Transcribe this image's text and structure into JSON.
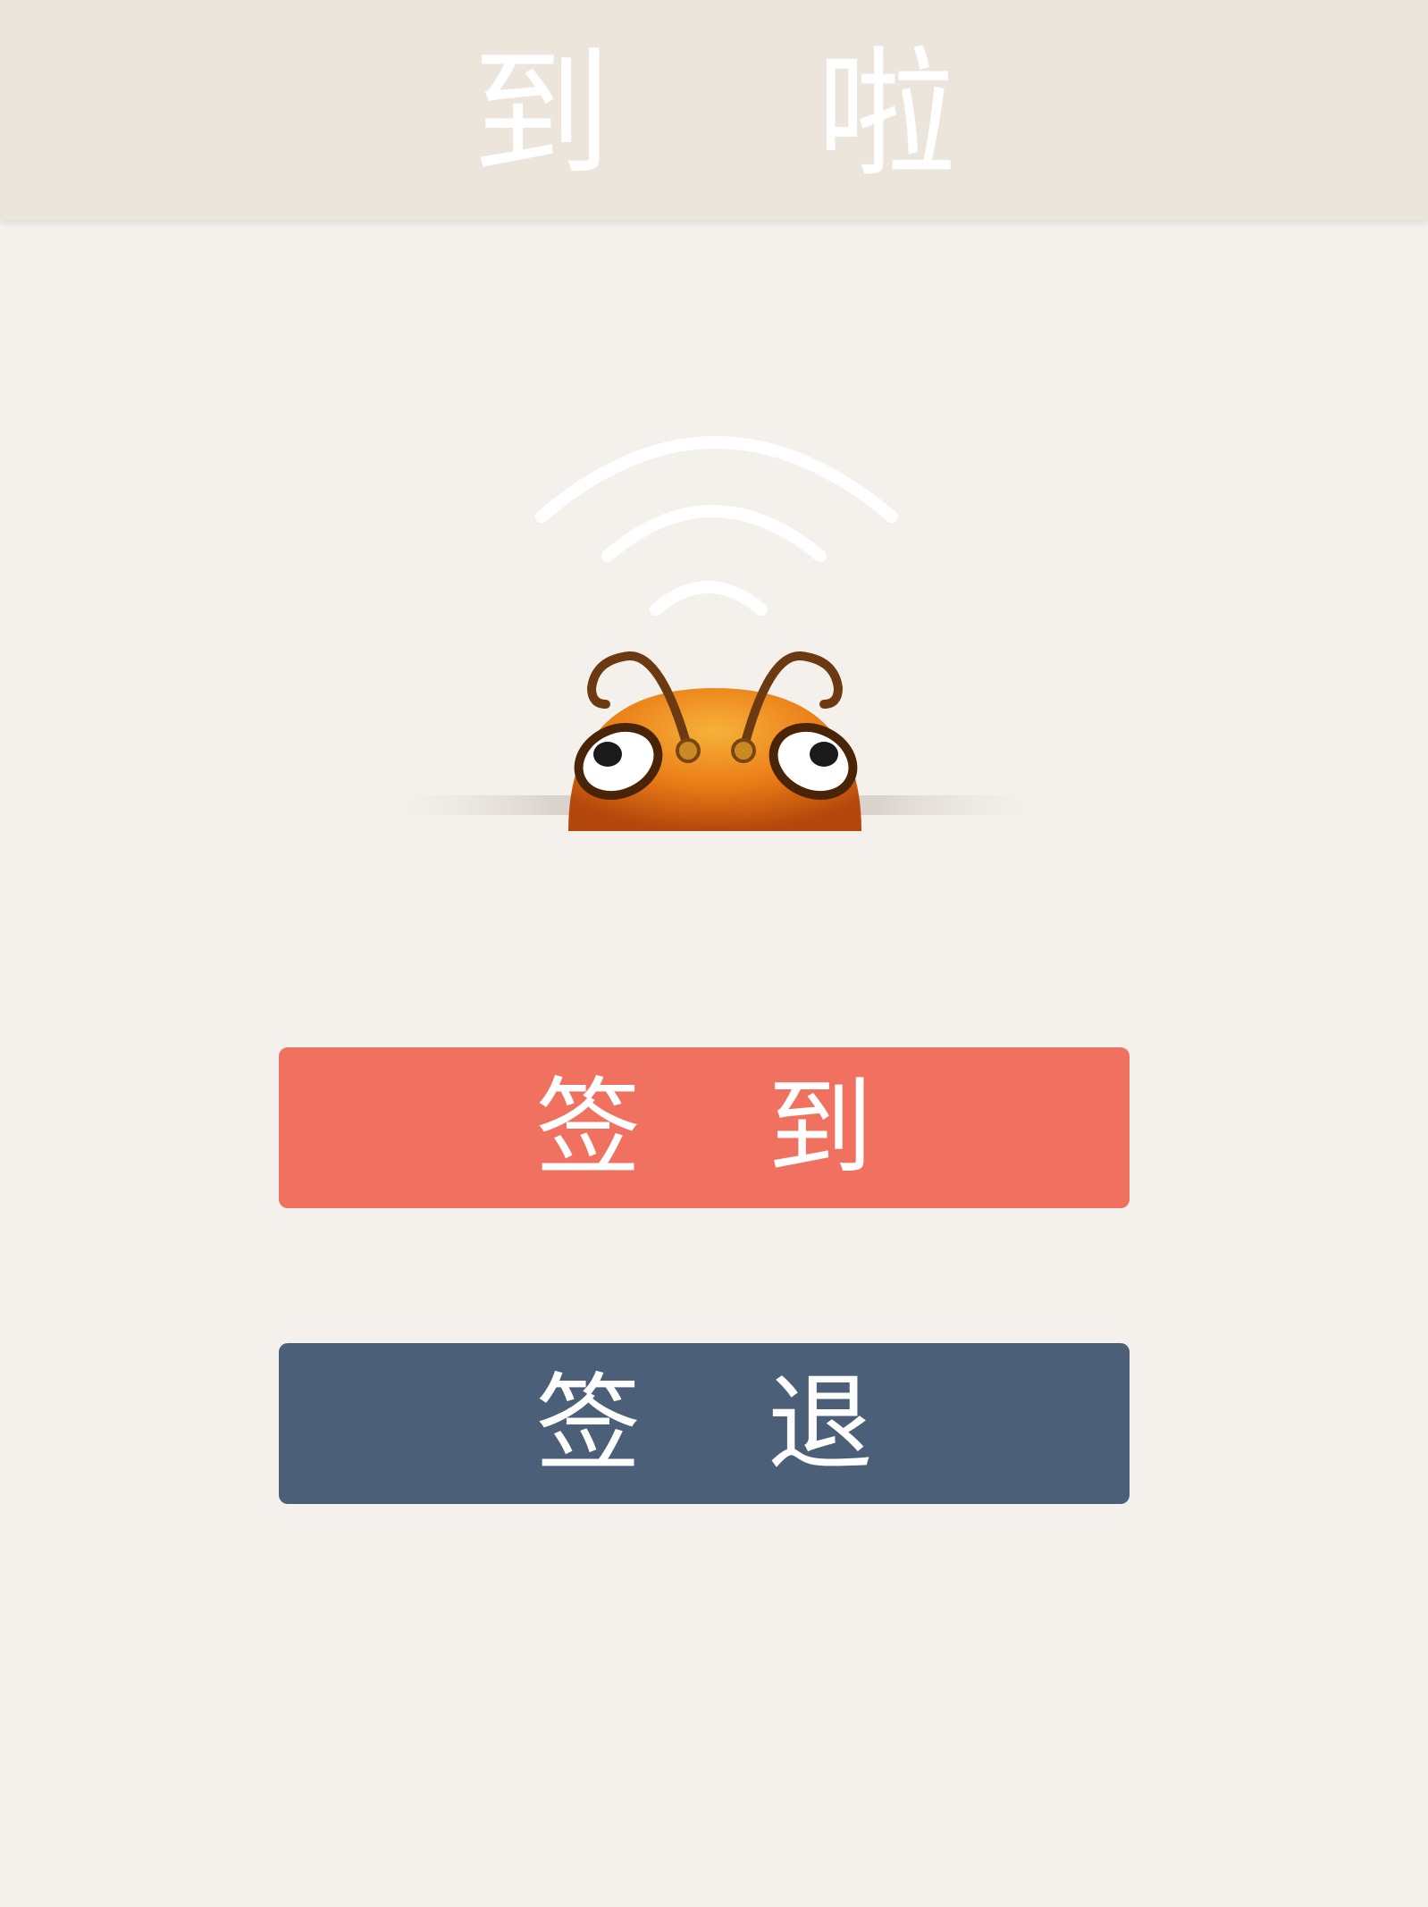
{
  "header": {
    "title": "到 啦"
  },
  "mascot": {
    "icon": "bug-mascot-with-signal-icon",
    "signal_color": "#ffffff",
    "body_color": "#f08a1a",
    "antenna_color": "#6b3a12"
  },
  "actions": {
    "signin_label": "签 到",
    "signin_color": "#f07160",
    "signout_label": "签 退",
    "signout_color": "#4b6078"
  },
  "colors": {
    "background": "#f4f1ec",
    "header_background": "#ece5db",
    "text": "#ffffff"
  }
}
